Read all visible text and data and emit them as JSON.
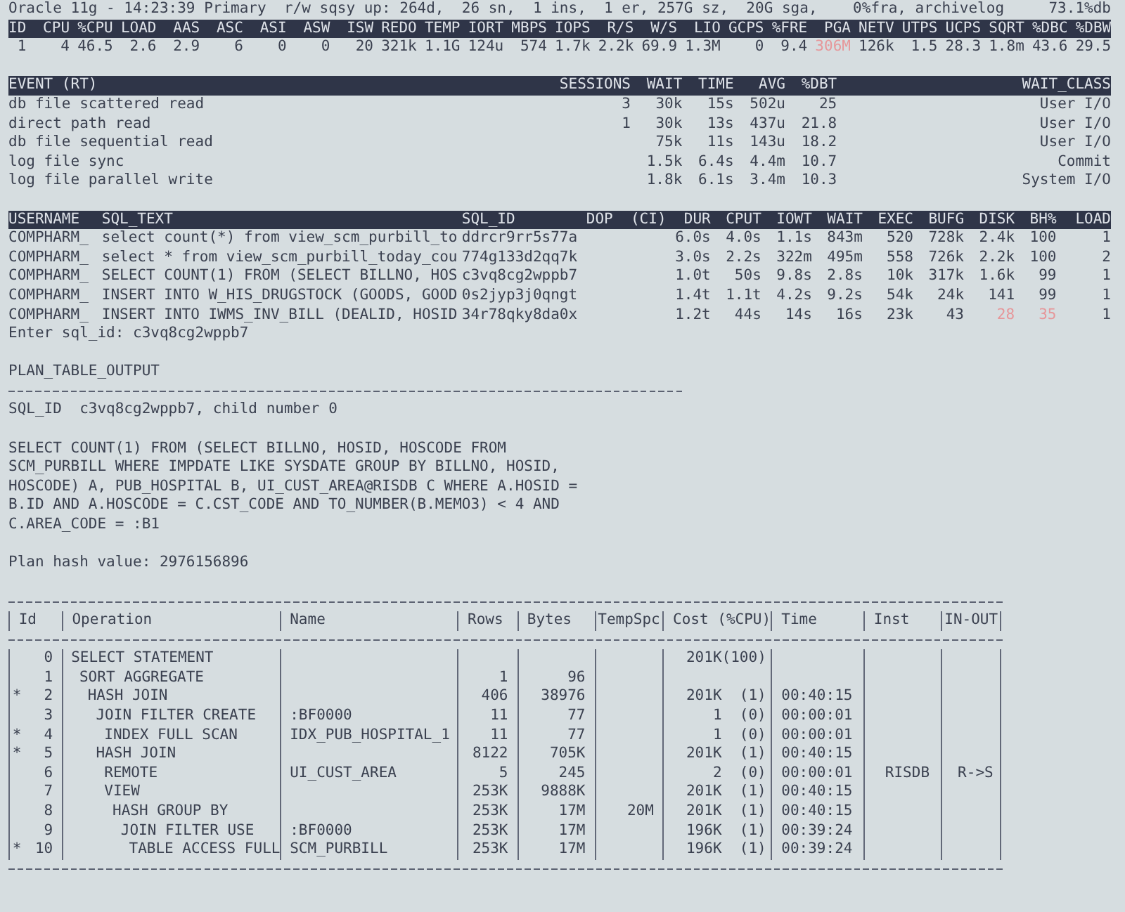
{
  "status_line": {
    "text": "Oracle 11g - 14:23:39 Primary  r/w sqsy up: 264d,  26 sn,  1 ins,  1 er, 257G sz,  20G sga,    0%fra, archivelog",
    "right": "73.1%db"
  },
  "metrics": {
    "columns": [
      "ID",
      "CPU",
      "%CPU",
      "LOAD",
      "AAS",
      "ASC",
      "ASI",
      "ASW",
      "ISW",
      "REDO",
      "TEMP",
      "IORT",
      "MBPS",
      "IOPS",
      "R/S",
      "W/S",
      "LIO",
      "GCPS",
      "%FRE",
      "PGA",
      "NETV",
      "UTPS",
      "UCPS",
      "SQRT",
      "%DBC",
      "%DBW"
    ],
    "values": [
      {
        "value": "1",
        "alert": false
      },
      {
        "value": "4",
        "alert": false
      },
      {
        "value": "46.5",
        "alert": false
      },
      {
        "value": "2.6",
        "alert": false
      },
      {
        "value": "2.9",
        "alert": false
      },
      {
        "value": "6",
        "alert": false
      },
      {
        "value": "0",
        "alert": false
      },
      {
        "value": "0",
        "alert": false
      },
      {
        "value": "20",
        "alert": false
      },
      {
        "value": "321k",
        "alert": false
      },
      {
        "value": "1.1G",
        "alert": false
      },
      {
        "value": "124u",
        "alert": false
      },
      {
        "value": "574",
        "alert": false
      },
      {
        "value": "1.7k",
        "alert": false
      },
      {
        "value": "2.2k",
        "alert": false
      },
      {
        "value": "69.9",
        "alert": false
      },
      {
        "value": "1.3M",
        "alert": false
      },
      {
        "value": "0",
        "alert": false
      },
      {
        "value": "9.4",
        "alert": false
      },
      {
        "value": "306M",
        "alert": true
      },
      {
        "value": "126k",
        "alert": false
      },
      {
        "value": "1.5",
        "alert": false
      },
      {
        "value": "28.3",
        "alert": false
      },
      {
        "value": "1.8m",
        "alert": false
      },
      {
        "value": "43.6",
        "alert": false
      },
      {
        "value": "29.5",
        "alert": false
      }
    ]
  },
  "events": {
    "columns": [
      "EVENT (RT)",
      "SESSIONS",
      "WAIT",
      "TIME",
      "AVG",
      "%DBT",
      "WAIT_CLASS"
    ],
    "rows": [
      {
        "event": "db file scattered read",
        "sessions": "3",
        "wait": "30k",
        "time": "15s",
        "avg": "502u",
        "dbt": "25",
        "wait_class": "User I/O"
      },
      {
        "event": "direct path read",
        "sessions": "1",
        "wait": "30k",
        "time": "13s",
        "avg": "437u",
        "dbt": "21.8",
        "wait_class": "User I/O"
      },
      {
        "event": "db file sequential read",
        "wait": "75k",
        "time": "11s",
        "avg": "143u",
        "dbt": "18.2",
        "wait_class": "User I/O"
      },
      {
        "event": "log file sync",
        "wait": "1.5k",
        "time": "6.4s",
        "avg": "4.4m",
        "dbt": "10.7",
        "wait_class": "Commit"
      },
      {
        "event": "log file parallel write",
        "wait": "1.8k",
        "time": "6.1s",
        "avg": "3.4m",
        "dbt": "10.3",
        "wait_class": "System I/O"
      }
    ]
  },
  "sql": {
    "columns": [
      "USERNAME",
      "SQL_TEXT",
      "SQL_ID",
      "DOP",
      "(CI)",
      "DUR",
      "CPUT",
      "IOWT",
      "WAIT",
      "EXEC",
      "BUFG",
      "DISK",
      "BH%",
      "LOAD"
    ],
    "rows": [
      {
        "username": "COMPHARM_",
        "sql_text": "select count(*) from view_scm_purbill_to",
        "sql_id": "ddrcr9rr5s77a",
        "dur": "6.0s",
        "cput": "4.0s",
        "iowt": "1.1s",
        "wait": "843m",
        "exec": "520",
        "bufg": "728k",
        "disk": "2.4k",
        "bh": "100",
        "load": "1",
        "disk_alert": false,
        "bh_alert": false
      },
      {
        "username": "COMPHARM_",
        "sql_text": "select * from view_scm_purbill_today_cou",
        "sql_id": "774g133d2qq7k",
        "dur": "3.0s",
        "cput": "2.2s",
        "iowt": "322m",
        "wait": "495m",
        "exec": "558",
        "bufg": "726k",
        "disk": "2.2k",
        "bh": "100",
        "load": "2",
        "disk_alert": false,
        "bh_alert": false
      },
      {
        "username": "COMPHARM_",
        "sql_text": "SELECT COUNT(1) FROM (SELECT BILLNO, HOS",
        "sql_id": "c3vq8cg2wppb7",
        "dur": "1.0t",
        "cput": "50s",
        "iowt": "9.8s",
        "wait": "2.8s",
        "exec": "10k",
        "bufg": "317k",
        "disk": "1.6k",
        "bh": "99",
        "load": "1",
        "disk_alert": false,
        "bh_alert": false
      },
      {
        "username": "COMPHARM_",
        "sql_text": "INSERT INTO W_HIS_DRUGSTOCK (GOODS, GOOD",
        "sql_id": "0s2jyp3j0qngt",
        "dur": "1.4t",
        "cput": "1.1t",
        "iowt": "4.2s",
        "wait": "9.2s",
        "exec": "54k",
        "bufg": "24k",
        "disk": "141",
        "bh": "99",
        "load": "1",
        "disk_alert": false,
        "bh_alert": false
      },
      {
        "username": "COMPHARM_",
        "sql_text": "INSERT INTO IWMS_INV_BILL (DEALID, HOSID",
        "sql_id": "34r78qky8da0x",
        "dur": "1.2t",
        "cput": "44s",
        "iowt": "14s",
        "wait": "16s",
        "exec": "23k",
        "bufg": "43",
        "disk": "28",
        "bh": "35",
        "load": "1",
        "disk_alert": true,
        "bh_alert": true
      }
    ]
  },
  "prompt": "Enter sql_id: c3vq8cg2wppb7",
  "plan_title": "PLAN_TABLE_OUTPUT",
  "sql_id_line": "SQL_ID  c3vq8cg2wppb7, child number 0",
  "sql_text_lines": [
    "SELECT COUNT(1) FROM (SELECT BILLNO, HOSID, HOSCODE FROM",
    "SCM_PURBILL WHERE IMPDATE LIKE SYSDATE GROUP BY BILLNO, HOSID,",
    "HOSCODE) A, PUB_HOSPITAL B, UI_CUST_AREA@RISDB C WHERE A.HOSID =",
    "B.ID AND A.HOSCODE = C.CST_CODE AND TO_NUMBER(B.MEMO3) < 4 AND",
    "C.AREA_CODE = :B1"
  ],
  "plan_hash": "Plan hash value: 2976156896",
  "plan_table": {
    "columns": [
      "Id",
      "Operation",
      "Name",
      "Rows",
      "Bytes",
      "TempSpc",
      "Cost (%CPU)",
      "Time",
      "Inst",
      "IN-OUT"
    ],
    "rows": [
      {
        "id": "0",
        "operation": "SELECT STATEMENT",
        "cost": "201K",
        "cpu": "(100)",
        "children": [
          {
            "id": "1",
            "operation": "SORT AGGREGATE",
            "rows": "1",
            "bytes": "96",
            "children": [
              {
                "id": "2",
                "marker": "*",
                "operation": "HASH JOIN",
                "rows": "406",
                "bytes": "38976",
                "cost": "201K",
                "cpu": "(1)",
                "time": "00:40:15",
                "children": [
                  {
                    "id": "3",
                    "operation": "JOIN FILTER CREATE",
                    "name": ":BF0000",
                    "rows": "11",
                    "bytes": "77",
                    "cost": "1",
                    "cpu": "(0)",
                    "time": "00:00:01",
                    "children": [
                      {
                        "id": "4",
                        "marker": "*",
                        "operation": "INDEX FULL SCAN",
                        "name": "IDX_PUB_HOSPITAL_1",
                        "rows": "11",
                        "bytes": "77",
                        "cost": "1",
                        "cpu": "(0)",
                        "time": "00:00:01"
                      }
                    ]
                  },
                  {
                    "id": "5",
                    "marker": "*",
                    "operation": "HASH JOIN",
                    "rows": "8122",
                    "bytes": "705K",
                    "cost": "201K",
                    "cpu": "(1)",
                    "time": "00:40:15",
                    "children": [
                      {
                        "id": "6",
                        "operation": "REMOTE",
                        "name": "UI_CUST_AREA",
                        "rows": "5",
                        "bytes": "245",
                        "cost": "2",
                        "cpu": "(0)",
                        "time": "00:00:01",
                        "inst": "RISDB",
                        "in_out": "R->S"
                      },
                      {
                        "id": "7",
                        "operation": "VIEW",
                        "rows": "253K",
                        "bytes": "9888K",
                        "cost": "201K",
                        "cpu": "(1)",
                        "time": "00:40:15",
                        "children": [
                          {
                            "id": "8",
                            "operation": "HASH GROUP BY",
                            "rows": "253K",
                            "bytes": "17M",
                            "temp_spc": "20M",
                            "cost": "201K",
                            "cpu": "(1)",
                            "time": "00:40:15",
                            "children": [
                              {
                                "id": "9",
                                "operation": "JOIN FILTER USE",
                                "name": ":BF0000",
                                "rows": "253K",
                                "bytes": "17M",
                                "cost": "196K",
                                "cpu": "(1)",
                                "time": "00:39:24",
                                "children": [
                                  {
                                    "id": "10",
                                    "marker": "*",
                                    "operation": "TABLE ACCESS FULL",
                                    "name": "SCM_PURBILL",
                                    "rows": "253K",
                                    "bytes": "17M",
                                    "cost": "196K",
                                    "cpu": "(1)",
                                    "time": "00:39:24"
                                  }
                                ]
                              }
                            ]
                          }
                        ]
                      }
                    ]
                  }
                ]
              }
            ]
          }
        ]
      }
    ]
  }
}
